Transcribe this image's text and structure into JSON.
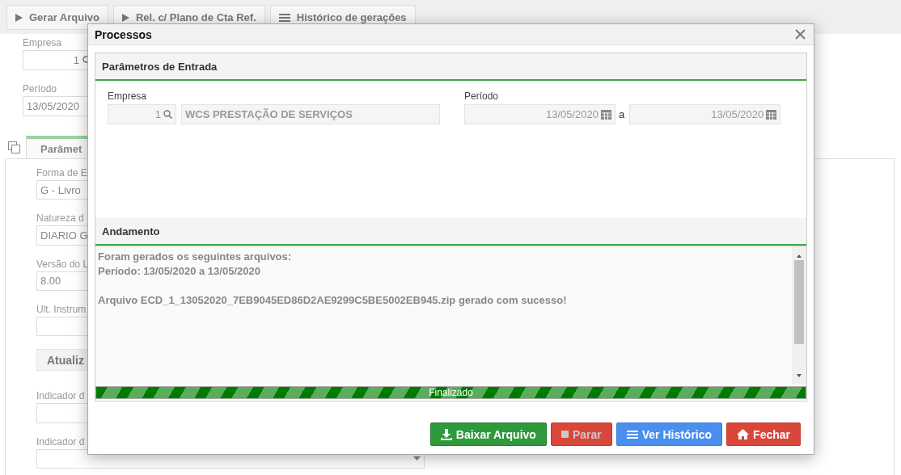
{
  "toolbar": [
    {
      "label": "Gerar Arquivo"
    },
    {
      "label": "Rel. c/ Plano de Cta Ref."
    },
    {
      "label": "Histórico de gerações"
    }
  ],
  "page_fields": [
    {
      "label": "Empresa",
      "value": "1",
      "kind": "lookup"
    },
    {
      "label": "Período",
      "value": "13/05/2020",
      "kind": "text"
    }
  ],
  "page_tab": {
    "label": "Parâmet",
    "selected": true
  },
  "panel_fields": [
    {
      "label": "Forma de E",
      "value": "G - Livro",
      "kind": "text"
    },
    {
      "label": "Natureza d",
      "value": "DIARIO G",
      "kind": "text"
    },
    {
      "label": "Versão do L",
      "value": "8.00",
      "kind": "text"
    },
    {
      "label": "Ult. Instrum",
      "kind": "text"
    },
    {
      "label": "Atualiz",
      "kind": "button"
    },
    {
      "label": "Indicador d",
      "kind": "text"
    },
    {
      "label": "Indicador d",
      "kind": "select"
    }
  ],
  "dialog": {
    "title": "Processos",
    "params": {
      "title": "Parâmetros de Entrada",
      "empresa": {
        "label": "Empresa",
        "code": "1",
        "name": "WCS PRESTAÇÃO DE SERVIÇOS",
        "disabled": true
      },
      "periodo": {
        "label": "Período",
        "from": "13/05/2020",
        "separator": "a",
        "to": "13/05/2020",
        "disabled": true
      }
    },
    "progress": {
      "title": "Andamento",
      "log": [
        {
          "lines": [
            "Foram gerados os seguintes arquivos:",
            "Período: 13/05/2020 a 13/05/2020"
          ]
        },
        {
          "lines": [
            "Arquivo ECD_1_13052020_7EB9045ED86D2AE9299C5BE5002EB945.zip gerado com sucesso!"
          ]
        }
      ],
      "status": "Finalizado",
      "level": 1
    },
    "buttons": [
      {
        "label": "Baixar Arquivo",
        "kind": "success",
        "disabled": false
      },
      {
        "label": "Parar",
        "kind": "danger",
        "disabled": true
      },
      {
        "label": "Ver Histórico",
        "kind": "primary",
        "disabled": false
      },
      {
        "label": "Fechar",
        "kind": "danger",
        "disabled": false
      }
    ]
  }
}
